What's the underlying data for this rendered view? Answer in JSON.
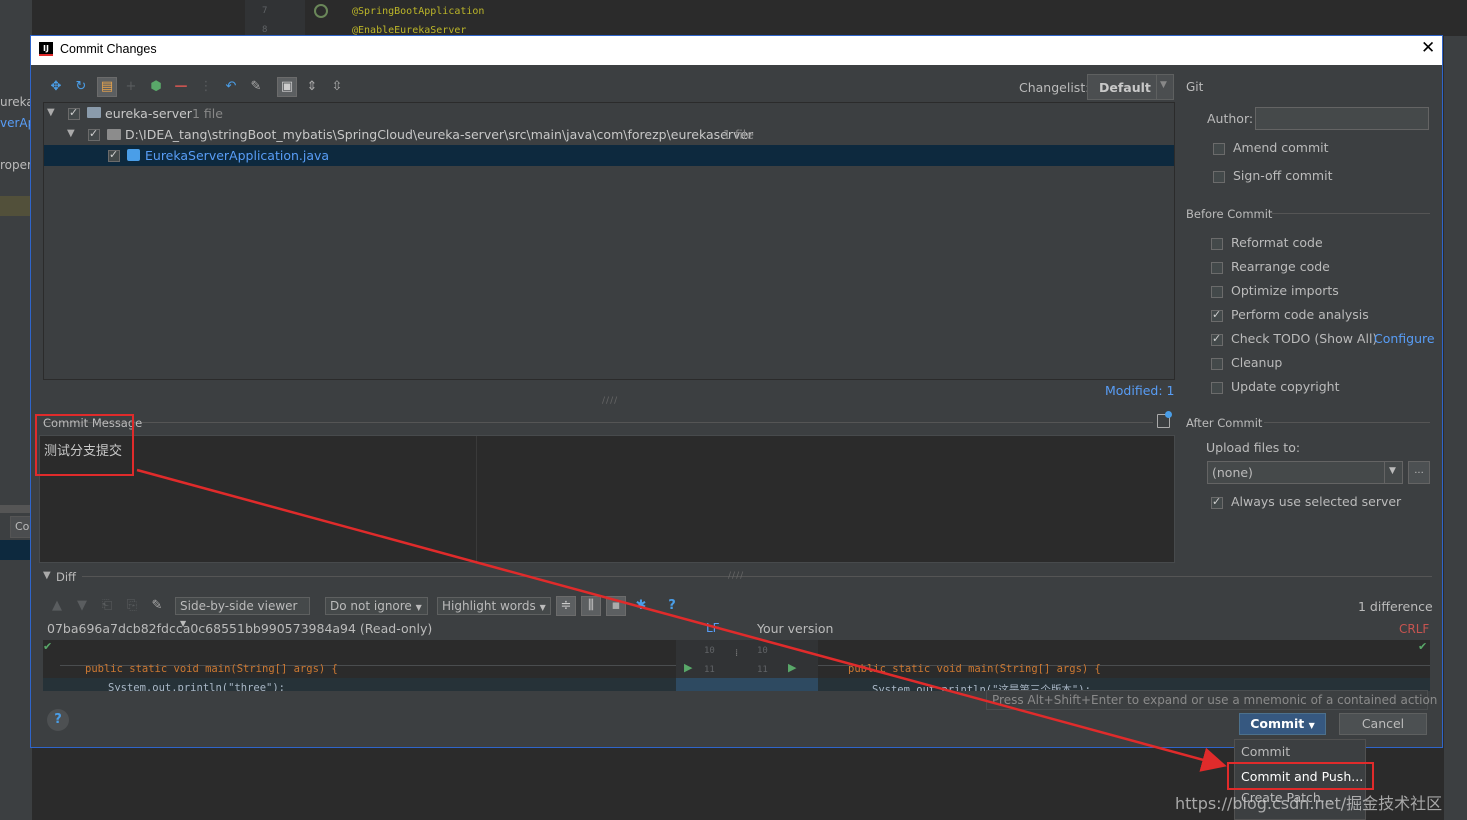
{
  "background": {
    "code_line_7": "@SpringBootApplication",
    "code_line_8": "@EnableEurekaServer",
    "line_numbers": [
      "7",
      "8"
    ],
    "left_fragments": [
      "ureka",
      "verAp",
      "roper"
    ],
    "bottom_tab": "Co"
  },
  "dialog": {
    "title": "Commit Changes",
    "changelist_label": "Changelist:",
    "changelist_value": "Default",
    "git_label": "Git",
    "tree": [
      {
        "label": "eureka-server",
        "count": "1 file"
      },
      {
        "label": "D:\\IDEA_tang\\stringBoot_mybatis\\SpringCloud\\eureka-server\\src\\main\\java\\com\\forezp\\eurekaserver",
        "count": "1 file"
      },
      {
        "label": "EurekaServerApplication.java",
        "count": ""
      }
    ],
    "modified": "Modified: 1",
    "commit_message_label": "Commit Message",
    "commit_message_text": "测试分支提交",
    "diff_label": "Diff",
    "diff_toolbar": {
      "viewer": "Side-by-side viewer",
      "ignore": "Do not ignore",
      "highlight": "Highlight words",
      "differences": "1 difference"
    },
    "left_version": "07ba696a7dcb82fdcca0c68551bb990573984a94 (Read-only)",
    "lf_label": "LF",
    "right_version": "Your version",
    "crlf_label": "CRLF",
    "diff_line_numbers": [
      "10",
      "11",
      "10",
      "11"
    ],
    "left_code_1": "public static void main(String[] args) {",
    "left_code_2": "System.out.println(\"three\");",
    "right_code_1": "public static void main(String[] args) {",
    "right_code_2": "System.out.println(\"这是第三个版本\");",
    "hint": "Press Alt+Shift+Enter to expand or use a mnemonic of a contained action",
    "git_panel": {
      "author_label": "Author:",
      "amend": "Amend commit",
      "signoff": "Sign-off commit",
      "before_commit": "Before Commit",
      "options": [
        {
          "label": "Reformat code",
          "checked": false
        },
        {
          "label": "Rearrange code",
          "checked": false
        },
        {
          "label": "Optimize imports",
          "checked": false
        },
        {
          "label": "Perform code analysis",
          "checked": true
        },
        {
          "label": "Check TODO (Show All)",
          "checked": true
        },
        {
          "label": "Cleanup",
          "checked": false
        },
        {
          "label": "Update copyright",
          "checked": false
        }
      ],
      "configure_link": "Configure",
      "after_commit": "After Commit",
      "upload_label": "Upload files to:",
      "upload_value": "(none)",
      "always_use": "Always use selected server"
    },
    "buttons": {
      "commit": "Commit",
      "cancel": "Cancel"
    },
    "commit_menu": [
      "Commit",
      "Commit and Push...",
      "Create Patch..."
    ]
  },
  "watermark": "https://blog.csdn.net/掘金技术社区",
  "colors": {
    "accent": "#2f65ca",
    "annotation": "#e02b2b",
    "link": "#589df6"
  }
}
